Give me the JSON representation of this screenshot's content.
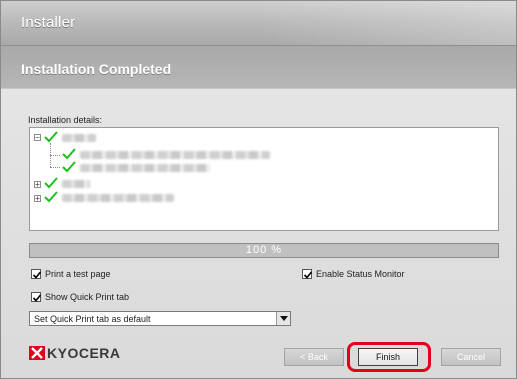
{
  "window": {
    "title": "Installer"
  },
  "header": {
    "title": "Installation Completed"
  },
  "details": {
    "label": "Installation details:",
    "progress_text": "100 %",
    "progress_fraction": 1.0
  },
  "options": {
    "print_test_page": {
      "label": "Print a test page",
      "checked": true
    },
    "enable_status_monitor": {
      "label": "Enable Status Monitor",
      "checked": true
    },
    "show_quick_print_tab": {
      "label": "Show Quick Print tab",
      "checked": true
    },
    "default_tab_select": {
      "value": "Set Quick Print tab as default"
    }
  },
  "brand": {
    "logo_text": "KYOCERA",
    "color": "#e2001a"
  },
  "buttons": {
    "back": "< Back",
    "finish": "Finish",
    "cancel": "Cancel"
  },
  "colors": {
    "check": "#1fbf1f",
    "highlight_ring": "#e2001a"
  }
}
